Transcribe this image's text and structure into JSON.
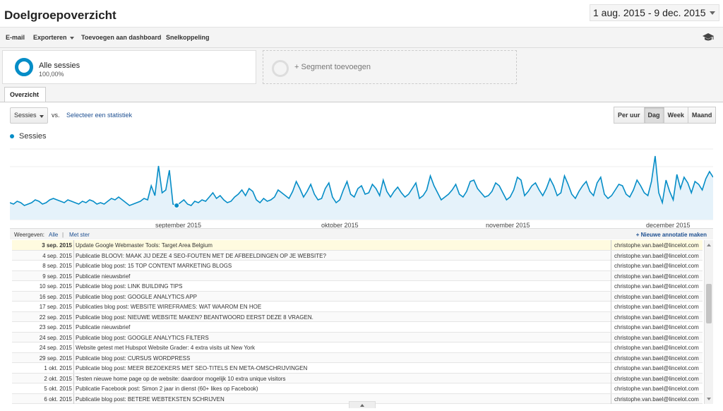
{
  "header": {
    "title": "Doelgroepoverzicht",
    "date_range": "1 aug. 2015 - 9 dec. 2015"
  },
  "toolbar": {
    "email": "E-mail",
    "export": "Exporteren",
    "add_dashboard": "Toevoegen aan dashboard",
    "shortcut": "Snelkoppeling"
  },
  "segments": {
    "active_name": "Alle sessies",
    "active_pct": "100,00%",
    "add_label": "+ Segment toevoegen"
  },
  "tabs": {
    "overview": "Overzicht"
  },
  "controls": {
    "metric": "Sessies",
    "vs": "vs.",
    "select_stat": "Selecteer een statistiek",
    "granularity": [
      "Per uur",
      "Dag",
      "Week",
      "Maand"
    ],
    "active_granularity": "Dag"
  },
  "colors": {
    "series": "#058dc7",
    "fill": "#e5f2fa",
    "link": "#1d4f91"
  },
  "chart_data": {
    "type": "area",
    "series": [
      {
        "name": "Sessies",
        "values": [
          12,
          11,
          13,
          12,
          10,
          11,
          12,
          14,
          13,
          11,
          12,
          14,
          15,
          14,
          13,
          12,
          14,
          13,
          12,
          11,
          13,
          12,
          14,
          13,
          11,
          12,
          11,
          13,
          15,
          14,
          16,
          14,
          12,
          10,
          11,
          12,
          13,
          15,
          14,
          24,
          17,
          38,
          19,
          21,
          35,
          11,
          10,
          12,
          14,
          11,
          10,
          13,
          12,
          14,
          13,
          16,
          19,
          15,
          17,
          14,
          12,
          13,
          16,
          18,
          21,
          17,
          22,
          20,
          14,
          12,
          15,
          13,
          14,
          16,
          21,
          19,
          17,
          15,
          20,
          27,
          22,
          16,
          20,
          25,
          18,
          14,
          15,
          22,
          26,
          16,
          12,
          14,
          21,
          27,
          18,
          16,
          22,
          24,
          18,
          19,
          25,
          22,
          17,
          28,
          20,
          16,
          20,
          23,
          19,
          16,
          18,
          22,
          26,
          15,
          17,
          21,
          31,
          24,
          19,
          14,
          16,
          18,
          21,
          25,
          18,
          16,
          20,
          27,
          28,
          22,
          19,
          16,
          17,
          20,
          26,
          24,
          19,
          14,
          16,
          21,
          30,
          28,
          17,
          20,
          24,
          26,
          21,
          17,
          22,
          29,
          24,
          17,
          19,
          31,
          25,
          18,
          15,
          20,
          24,
          27,
          20,
          17,
          26,
          30,
          18,
          15,
          17,
          21,
          25,
          24,
          18,
          16,
          21,
          28,
          24,
          19,
          17,
          27,
          45,
          19,
          12,
          28,
          20,
          14,
          32,
          22,
          30,
          26,
          19,
          27,
          25,
          21,
          29,
          34,
          30
        ]
      }
    ],
    "x_labels": [
      "september 2015",
      "oktober 2015",
      "november 2015",
      "december 2015"
    ],
    "grid": true,
    "legend": "top-left"
  },
  "annotations": {
    "show_label": "Weergeven:",
    "all": "Alle",
    "separator": "|",
    "starred": "Met ster",
    "new": "+ Nieuwe annotatie maken",
    "rows": [
      {
        "date": "3 sep. 2015",
        "text": "Update Google Webmaster Tools: Target Area Belgium",
        "user": "christophe.van.bael@lincelot.com"
      },
      {
        "date": "4 sep. 2015",
        "text": "Publicatie BLOOVI: MAAK JIJ DEZE 4 SEO-FOUTEN MET DE AFBEELDINGEN OP JE WEBSITE?",
        "user": "christophe.van.bael@lincelot.com"
      },
      {
        "date": "8 sep. 2015",
        "text": "Publicatie blog post: 15 TOP CONTENT MARKETING BLOGS",
        "user": "christophe.van.bael@lincelot.com"
      },
      {
        "date": "9 sep. 2015",
        "text": "Publicatie nieuwsbrief",
        "user": "christophe.van.bael@lincelot.com"
      },
      {
        "date": "10 sep. 2015",
        "text": "Publicatie blog post: LINK BUILDING TIPS",
        "user": "christophe.van.bael@lincelot.com"
      },
      {
        "date": "16 sep. 2015",
        "text": "Publicatie blog post: GOOGLE ANALYTICS APP",
        "user": "christophe.van.bael@lincelot.com"
      },
      {
        "date": "17 sep. 2015",
        "text": "Publicaties blog post: WEBSITE WIREFRAMES: WAT WAAROM EN HOE",
        "user": "christophe.van.bael@lincelot.com"
      },
      {
        "date": "22 sep. 2015",
        "text": "Publicatie blog post: NIEUWE WEBSITE MAKEN? BEANTWOORD EERST DEZE 8 VRAGEN.",
        "user": "christophe.van.bael@lincelot.com"
      },
      {
        "date": "23 sep. 2015",
        "text": "Publicatie nieuwsbrief",
        "user": "christophe.van.bael@lincelot.com"
      },
      {
        "date": "24 sep. 2015",
        "text": "Publicatie blog post: GOOGLE ANALYTICS FILTERS",
        "user": "christophe.van.bael@lincelot.com"
      },
      {
        "date": "24 sep. 2015",
        "text": "Website getest met Hubspot Website Grader: 4 extra visits uit New York",
        "user": "christophe.van.bael@lincelot.com"
      },
      {
        "date": "29 sep. 2015",
        "text": "Publicatie blog post: CURSUS WORDPRESS",
        "user": "christophe.van.bael@lincelot.com"
      },
      {
        "date": "1 okt. 2015",
        "text": "Publicatie blog post: MEER BEZOEKERS MET SEO-TITELS EN META-OMSCHRIJVINGEN",
        "user": "christophe.van.bael@lincelot.com"
      },
      {
        "date": "2 okt. 2015",
        "text": "Testen nieuwe home page op de website: daardoor mogelijk 10 extra unique visitors",
        "user": "christophe.van.bael@lincelot.com"
      },
      {
        "date": "5 okt. 2015",
        "text": "Publicatie Facebook post: Simon 2 jaar in dienst (60+ likes op Facebook)",
        "user": "christophe.van.bael@lincelot.com"
      },
      {
        "date": "6 okt. 2015",
        "text": "Publicatie blog post: BETERE WEBTEKSTEN SCHRIJVEN",
        "user": "christophe.van.bael@lincelot.com"
      }
    ]
  }
}
